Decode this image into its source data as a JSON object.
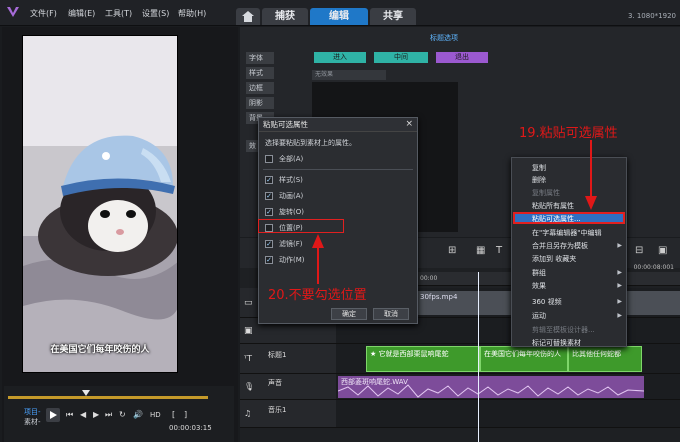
{
  "menubar": {
    "items": [
      "文件(F)",
      "编辑(E)",
      "工具(T)",
      "设置(S)",
      "帮助(H)"
    ],
    "tabs": [
      "捕获",
      "编辑",
      "共享"
    ],
    "active_tab": "编辑",
    "right_text": "3. 1080*1920"
  },
  "preview": {
    "subtitle": "在美国它们每年咬伤的人",
    "labels": [
      "项目-",
      "素材-"
    ],
    "hd": "HD",
    "timecode": "00:00:03:15"
  },
  "title_panel": {
    "heading": "标题选项",
    "side_tabs": [
      "字体",
      "样式",
      "边框",
      "阴影",
      "背景",
      "效"
    ],
    "buttons": [
      "进入",
      "中间",
      "退出"
    ],
    "button_colors": [
      "#2fb3a6",
      "#2fb3a6",
      "#9b59d0"
    ],
    "dropdown": "无效果"
  },
  "dialog": {
    "title": "粘贴可选属性",
    "close": "×",
    "prompt": "选择要粘贴到素材上的属性。",
    "options": [
      {
        "label": "全部(A)",
        "checked": false
      },
      {
        "label": "样式(S)",
        "checked": true
      },
      {
        "label": "动画(A)",
        "checked": true
      },
      {
        "label": "旋转(O)",
        "checked": true
      },
      {
        "label": "位置(P)",
        "checked": false
      },
      {
        "label": "滤镜(F)",
        "checked": true
      },
      {
        "label": "动作(M)",
        "checked": true
      }
    ],
    "ok": "确定",
    "cancel": "取消"
  },
  "context_menu": {
    "items": [
      {
        "label": "复制",
        "enabled": true,
        "submenu": false
      },
      {
        "label": "删除",
        "enabled": true,
        "submenu": false
      },
      {
        "label": "复制属性",
        "enabled": false,
        "submenu": false
      },
      {
        "label": "粘贴所有属性",
        "enabled": true,
        "submenu": false
      },
      {
        "label": "粘贴可选属性...",
        "enabled": true,
        "submenu": false,
        "highlighted": true
      },
      {
        "label": "在\"字幕编辑器\"中编辑",
        "enabled": true,
        "submenu": false
      },
      {
        "label": "合并且另存为模板",
        "enabled": true,
        "submenu": true
      },
      {
        "label": "添加到 收藏夹",
        "enabled": true,
        "submenu": false
      },
      {
        "label": "群组",
        "enabled": true,
        "submenu": true
      },
      {
        "label": "效果",
        "enabled": true,
        "submenu": true
      },
      {
        "label": "360 视频",
        "enabled": true,
        "submenu": true
      },
      {
        "label": "运动",
        "enabled": true,
        "submenu": true
      },
      {
        "label": "剪辑至模板设计器...",
        "enabled": false,
        "submenu": false
      },
      {
        "label": "标记可替换素材",
        "enabled": true,
        "submenu": false
      }
    ]
  },
  "annotations": {
    "step19": "19.粘贴可选属性",
    "step20": "20.不要勾选位置"
  },
  "timeline": {
    "ruler_left": "00:00",
    "ruler_right": "00:00:08:001",
    "tracks": [
      {
        "name": "",
        "clip": "30fps.mp4"
      },
      {
        "name": "",
        "clip": ""
      },
      {
        "name": "标题1",
        "clips": [
          "它就是西部栗鼠响尾蛇",
          "在美国它们每年咬伤的人",
          "比其他任何蛇都"
        ]
      },
      {
        "name": "声音",
        "clip": "西部菱斑响尾蛇.WAV"
      },
      {
        "name": "音乐1",
        "clip": ""
      }
    ]
  }
}
